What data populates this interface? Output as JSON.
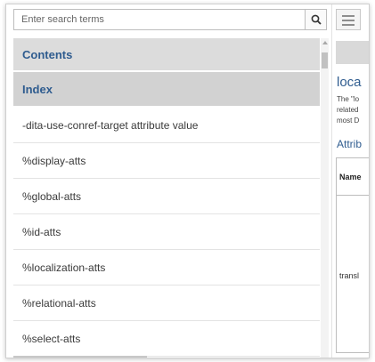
{
  "search": {
    "placeholder": "Enter search terms"
  },
  "nav": {
    "contents_label": "Contents",
    "index_label": "Index",
    "index_items": [
      "-dita-use-conref-target attribute value",
      "%display-atts",
      "%global-atts",
      "%id-atts",
      "%localization-atts",
      "%relational-atts",
      "%select-atts"
    ]
  },
  "topic": {
    "title": "loca",
    "body_lines": [
      "The \"lo",
      "related",
      "most D"
    ],
    "section_heading": "Attrib",
    "table_header": "Name",
    "table_cell": "transl"
  },
  "colors": {
    "accent": "#2f5c8f",
    "header_bg": "#dcdcdc"
  }
}
